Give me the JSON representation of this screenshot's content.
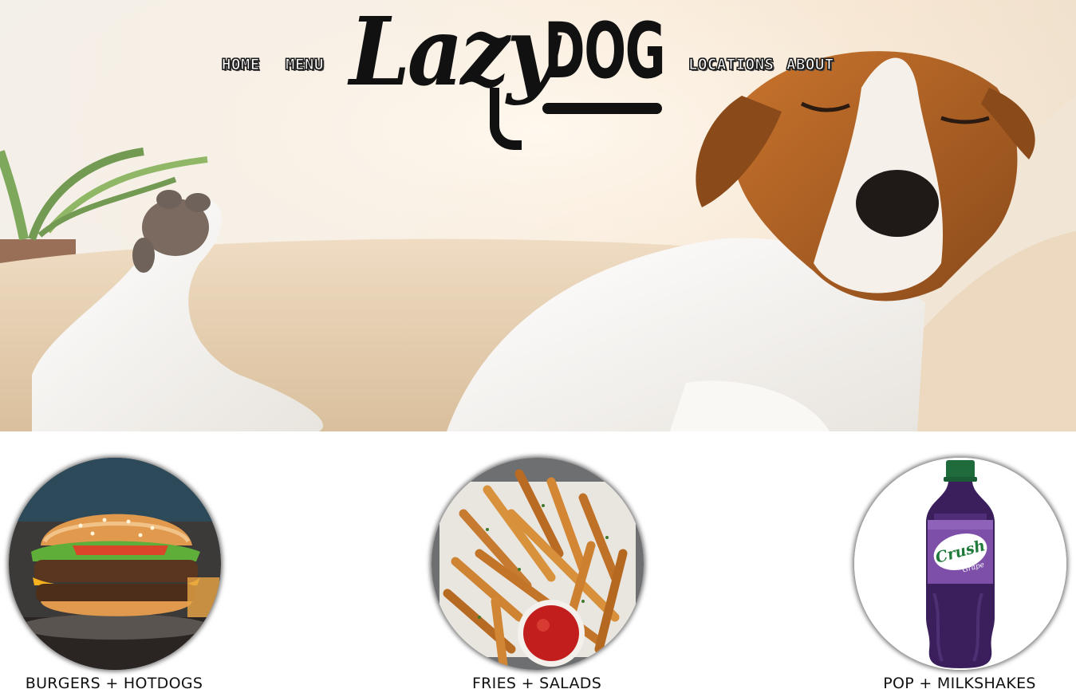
{
  "brand": {
    "logo_script": "Lazy",
    "logo_block": "DOG"
  },
  "nav": {
    "home": "HOME",
    "menu": "MENU",
    "locations": "LOCATIONS",
    "about": "ABOUT"
  },
  "categories": [
    {
      "label": "BURGERS + HOTDOGS",
      "image": "burger-photo"
    },
    {
      "label": "FRIES + SALADS",
      "image": "fries-photo"
    },
    {
      "label": "POP + MILKSHAKES",
      "image": "grape-crush-photo",
      "bottle_text": "Crush",
      "bottle_sub": "Grape"
    }
  ],
  "colors": {
    "text": "#111111",
    "background": "#ffffff",
    "nav_fill": "#ffffff",
    "nav_outline": "#1a1a1a"
  }
}
